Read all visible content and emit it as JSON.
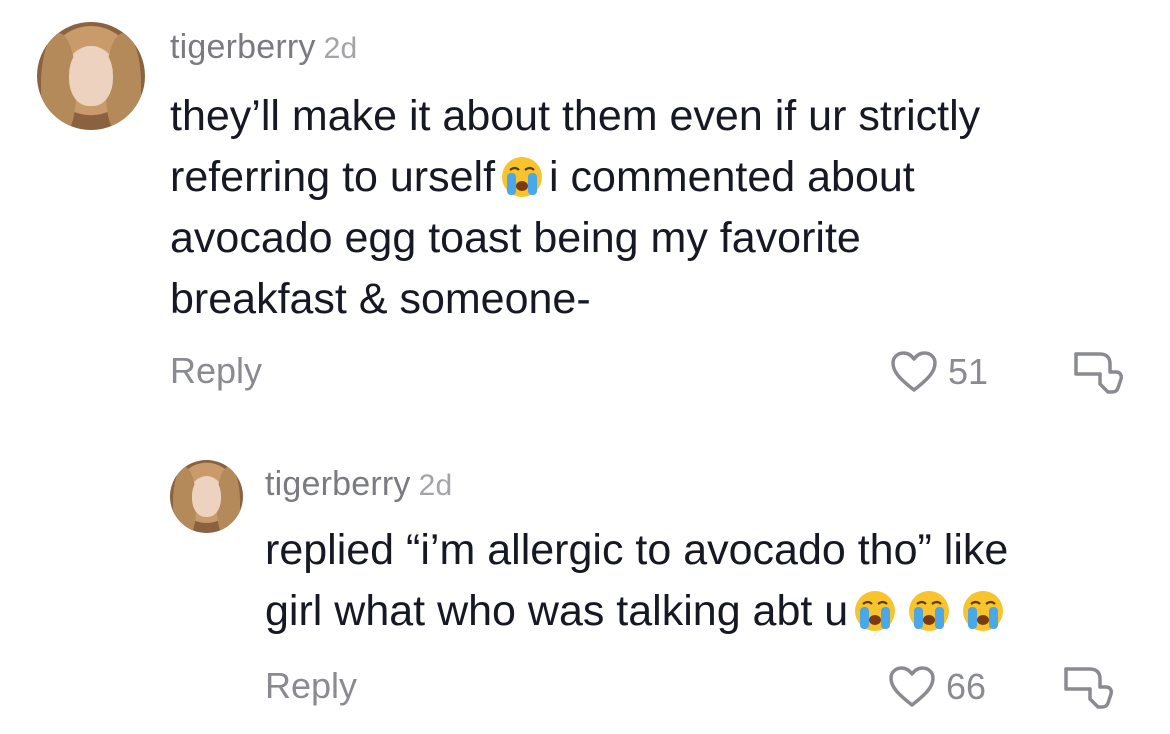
{
  "comments": [
    {
      "username": "tigerberry",
      "time": "2d",
      "lines": [
        "they’ll make it about them even if ur strictly",
        "referring to urself",
        "i commented about",
        "avocado egg toast being my favorite",
        "breakfast & someone-"
      ],
      "reply_label": "Reply",
      "likes": "51"
    },
    {
      "username": "tigerberry",
      "time": "2d",
      "lines": [
        "replied “i’m allergic to avocado tho” like",
        "girl what who was talking abt u"
      ],
      "reply_label": "Reply",
      "likes": "66"
    }
  ],
  "icons": {
    "avatar": "profile-photo",
    "emoji": "loudly-crying-face",
    "like": "heart-outline-icon",
    "dislike": "thumbs-down-outline-icon"
  },
  "colors": {
    "text": "#161823",
    "secondary": "#8a8b91",
    "emoji_yellow": "#f7c42d",
    "tears": "#4aa7e8"
  }
}
